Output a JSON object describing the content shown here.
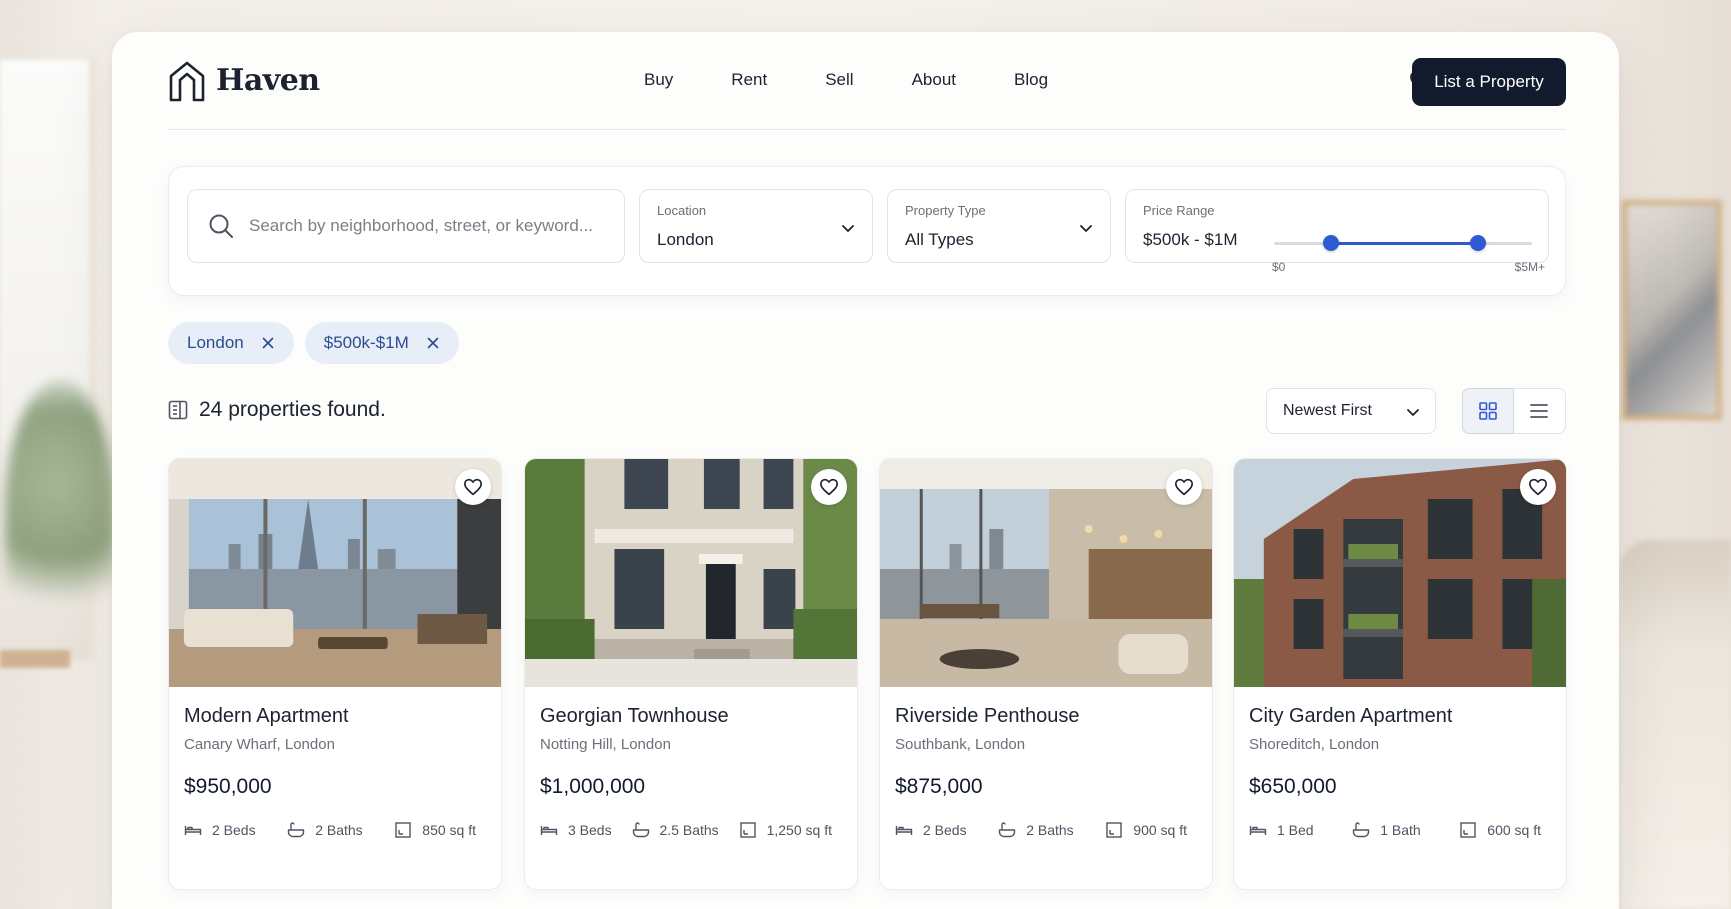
{
  "brand": {
    "name": "Haven"
  },
  "nav": [
    "Buy",
    "Rent",
    "Sell",
    "About",
    "Blog"
  ],
  "header": {
    "cta_label": "List a Property"
  },
  "search": {
    "placeholder": "Search by neighborhood, street, or keyword...",
    "location": {
      "label": "Location",
      "value": "London"
    },
    "property_type": {
      "label": "Property Type",
      "value": "All Types"
    },
    "price_range": {
      "label": "Price Range",
      "value": "$500k - $1M",
      "min_label": "$0",
      "max_label": "$5M+",
      "low": 0.22,
      "high": 0.79
    }
  },
  "chips": [
    "London",
    "$500k-$1M"
  ],
  "results": {
    "count_text": "24 properties found.",
    "sort": "Newest First",
    "view": "grid"
  },
  "colors": {
    "accent": "#2e5bd4",
    "primary_dark": "#121a2d",
    "chip_bg": "#e8eef8"
  },
  "listings": [
    {
      "title": "Modern Apartment",
      "location": "Canary Wharf, London",
      "price": "$950,000",
      "beds": "2 Beds",
      "baths": "2 Baths",
      "area": "850 sq ft"
    },
    {
      "title": "Georgian Townhouse",
      "location": "Notting Hill, London",
      "price": "$1,000,000",
      "beds": "3 Beds",
      "baths": "2.5 Baths",
      "area": "1,250 sq ft"
    },
    {
      "title": "Riverside Penthouse",
      "location": "Southbank, London",
      "price": "$875,000",
      "beds": "2 Beds",
      "baths": "2 Baths",
      "area": "900 sq ft"
    },
    {
      "title": "City Garden Apartment",
      "location": "Shoreditch, London",
      "price": "$650,000",
      "beds": "1 Bed",
      "baths": "1 Bath",
      "area": "600 sq ft"
    }
  ]
}
